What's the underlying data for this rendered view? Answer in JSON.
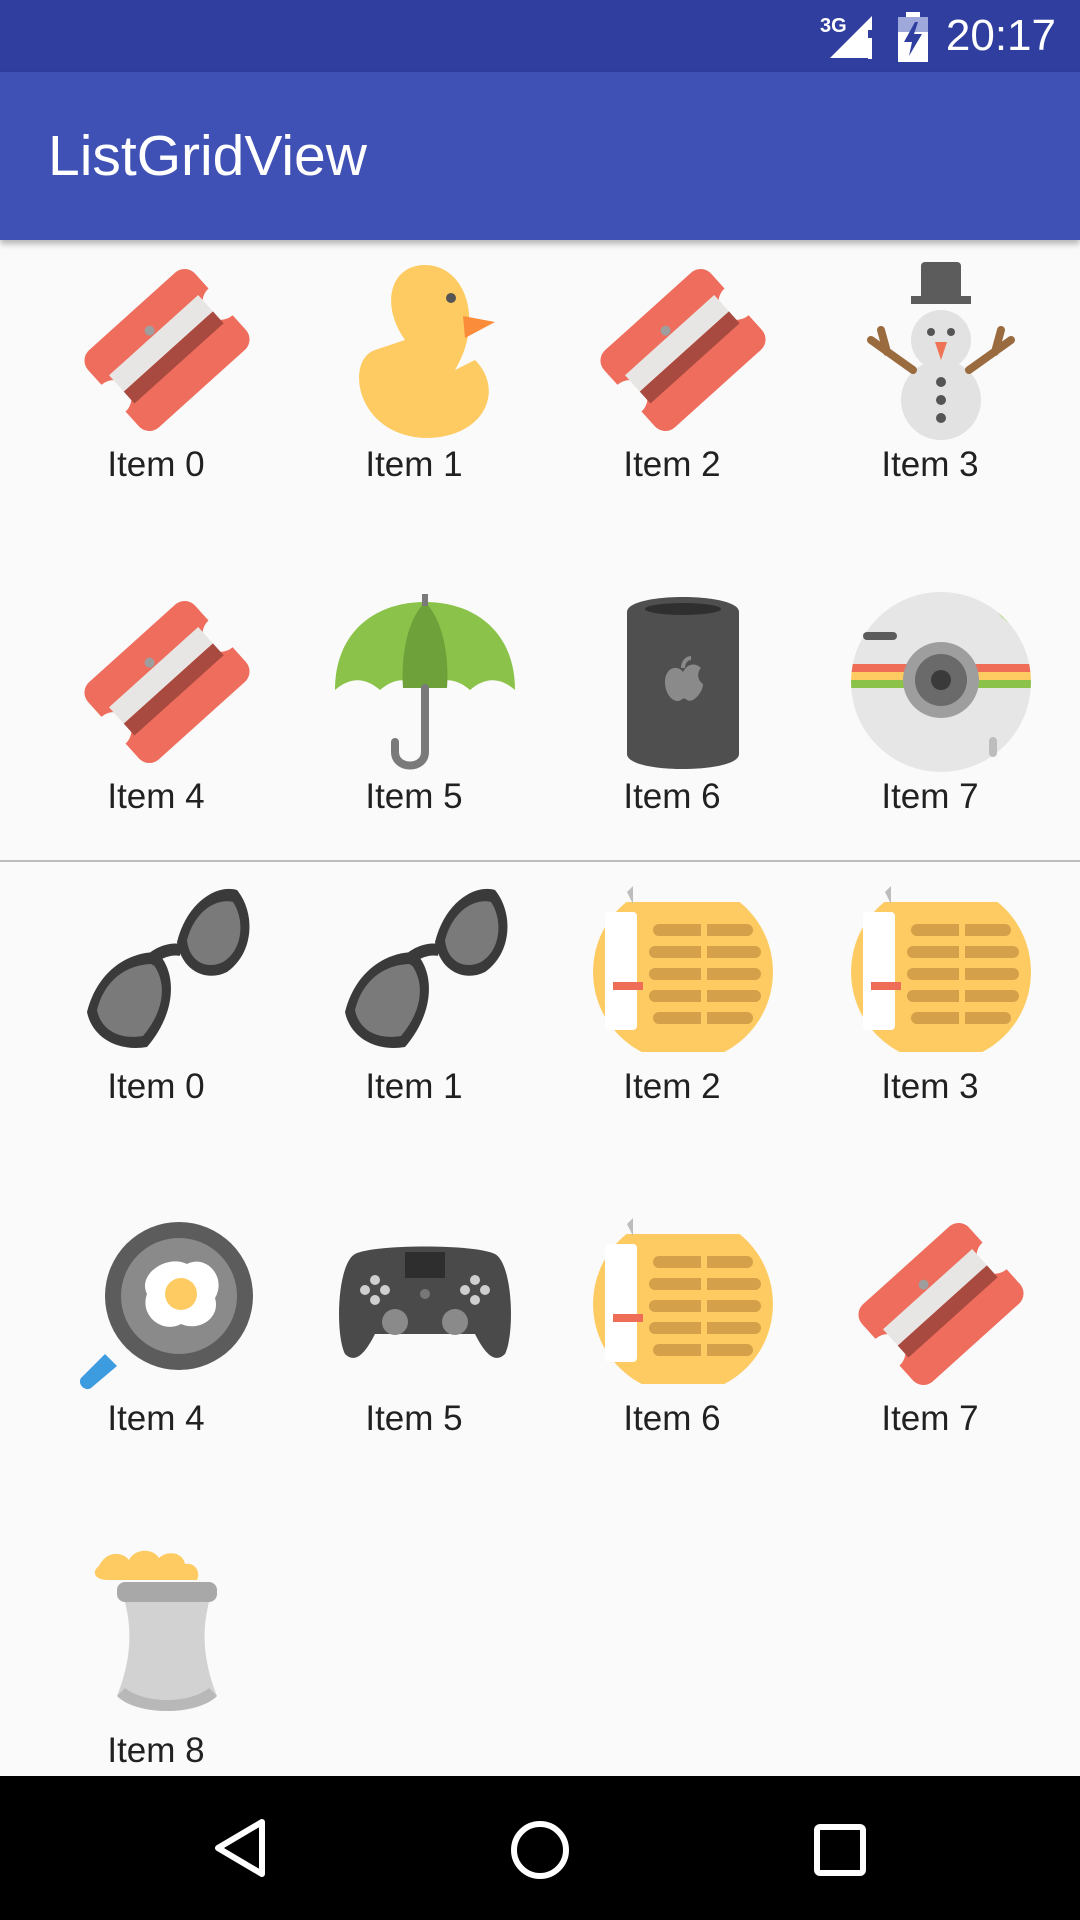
{
  "status_bar": {
    "network": "3G",
    "time": "20:17"
  },
  "app_bar": {
    "title": "ListGridView"
  },
  "list_a": {
    "items": [
      {
        "label": "Item 0",
        "icon": "sharpener-icon"
      },
      {
        "label": "Item 1",
        "icon": "duck-icon"
      },
      {
        "label": "Item 2",
        "icon": "sharpener-icon"
      },
      {
        "label": "Item 3",
        "icon": "snowman-icon"
      },
      {
        "label": "Item 4",
        "icon": "sharpener-icon"
      },
      {
        "label": "Item 5",
        "icon": "umbrella-icon"
      },
      {
        "label": "Item 6",
        "icon": "mac-pro-icon"
      },
      {
        "label": "Item 7",
        "icon": "camera-icon"
      }
    ]
  },
  "grid_b": {
    "items": [
      {
        "label": "Item 0",
        "icon": "sunglasses-icon"
      },
      {
        "label": "Item 1",
        "icon": "sunglasses-icon"
      },
      {
        "label": "Item 2",
        "icon": "radio-icon"
      },
      {
        "label": "Item 3",
        "icon": "radio-icon"
      },
      {
        "label": "Item 4",
        "icon": "frying-pan-icon"
      },
      {
        "label": "Item 5",
        "icon": "gamepad-icon"
      },
      {
        "label": "Item 6",
        "icon": "radio-icon"
      },
      {
        "label": "Item 7",
        "icon": "sharpener-icon"
      },
      {
        "label": "Item 8",
        "icon": "popcorn-icon"
      }
    ]
  },
  "nav_bar": {
    "buttons": [
      "back",
      "home",
      "recents"
    ]
  }
}
